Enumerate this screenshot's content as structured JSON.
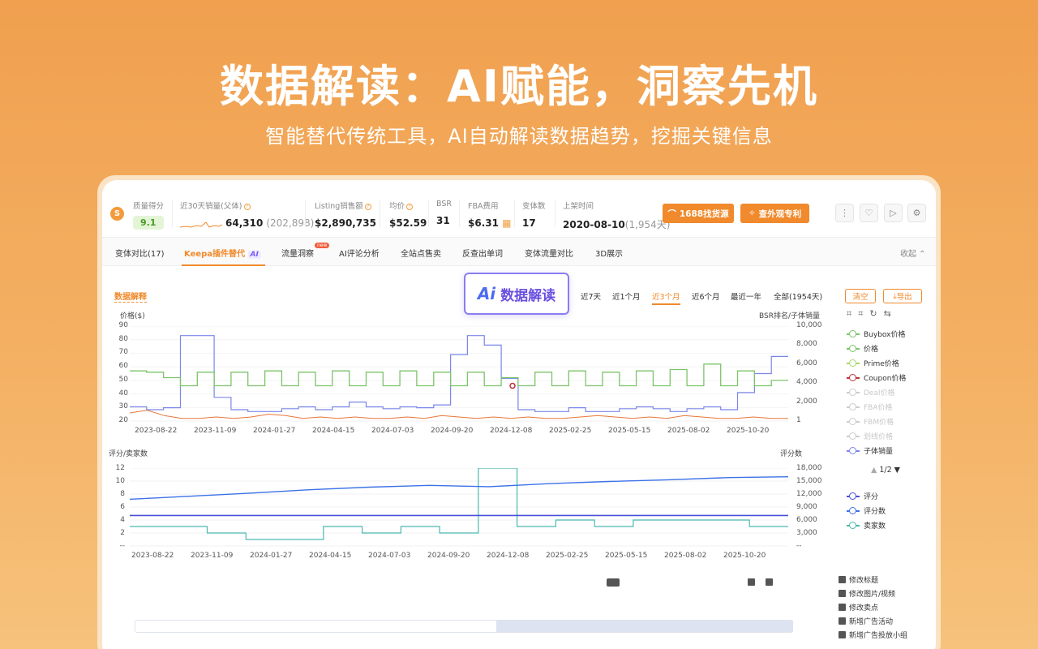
{
  "hero": {
    "title": "数据解读：AI赋能，洞察先机",
    "subtitle": "智能替代传统工具，AI自动解读数据趋势，挖掘关键信息"
  },
  "header": {
    "logo": "S",
    "metrics": [
      {
        "label": "质量得分",
        "value": "9.1"
      },
      {
        "label": "近30天销量(父体)",
        "value": "64,310",
        "value_muted": "(202,898)"
      },
      {
        "label": "Listing销售额",
        "value": "$2,890,735"
      },
      {
        "label": "均价",
        "value": "$52.59"
      },
      {
        "label": "BSR",
        "value": "31"
      },
      {
        "label": "FBA费用",
        "value": "$6.31"
      },
      {
        "label": "变体数",
        "value": "17"
      },
      {
        "label": "上架时间",
        "value": "2020-08-10",
        "value_muted": "(1,954天)"
      }
    ],
    "btn_1688": "1688找货源",
    "btn_patent": "查外观专利"
  },
  "tabs": [
    {
      "label": "变体对比(17)"
    },
    {
      "label": "Keepa插件替代"
    },
    {
      "label": "流量洞察"
    },
    {
      "label": "AI评论分析"
    },
    {
      "label": "全站点售卖"
    },
    {
      "label": "反查出单词"
    },
    {
      "label": "变体流量对比"
    },
    {
      "label": "3D展示"
    }
  ],
  "tab_ai_tag": "AI",
  "tab_new_tag": "new",
  "collapse_label": "收起",
  "toolbar": {
    "data_explain": "数据解释",
    "ai_mark": "Ai",
    "ai_label": "数据解读",
    "ranges": [
      "近7天",
      "近1个月",
      "近3个月",
      "近6个月",
      "最近一年",
      "全部(1954天)"
    ],
    "active_range": "近3个月",
    "clear": "清空",
    "export": "导出"
  },
  "chart_data": [
    {
      "type": "line",
      "ylabel": "价格($)",
      "y2label": "BSR排名/子体销量",
      "yticks": [
        "90",
        "80",
        "70",
        "60",
        "50",
        "40",
        "30",
        "20"
      ],
      "y2ticks": [
        "10,000",
        "8,000",
        "6,000",
        "4,000",
        "2,000",
        "1"
      ],
      "xticks": [
        "2023-08-22",
        "2023-11-09",
        "2024-01-27",
        "2024-04-15",
        "2024-07-03",
        "2024-09-20",
        "2024-12-08",
        "2025-02-25",
        "2025-05-15",
        "2025-08-02",
        "2025-10-20"
      ],
      "ylim": [
        20,
        90
      ],
      "y2lim": [
        1,
        10000
      ],
      "series": [
        {
          "name": "价格",
          "color": "#7cc46a",
          "values": [
            57,
            56,
            52,
            46,
            56,
            46,
            56,
            46,
            57,
            46,
            56,
            46,
            57,
            46,
            56,
            46,
            57,
            46,
            56,
            46,
            56,
            46,
            52,
            46,
            56,
            46,
            57,
            46,
            56,
            46,
            57,
            46,
            58,
            46,
            62,
            46,
            57,
            46,
            50
          ]
        },
        {
          "name": "子体销量",
          "color": "#7b86ea",
          "values": [
            1500,
            1200,
            1400,
            9000,
            9000,
            2500,
            1200,
            1000,
            1000,
            1300,
            1500,
            1200,
            1500,
            2000,
            1500,
            1300,
            1500,
            1400,
            1700,
            7000,
            9000,
            8000,
            4500,
            1200,
            1000,
            1000,
            1400,
            1000,
            1000,
            1300,
            1500,
            1300,
            1000,
            1300,
            1500,
            1200,
            3000,
            5000,
            6800
          ]
        },
        {
          "name": "Coupon价格",
          "color": "#e8763a",
          "values": [
            26,
            28,
            24,
            22,
            22,
            23,
            22,
            23,
            25,
            24,
            22,
            23,
            22,
            23,
            22,
            22,
            23,
            22,
            24,
            23,
            22,
            23,
            22,
            23,
            22,
            22,
            23,
            24,
            23,
            22,
            23,
            22,
            24,
            23,
            22,
            22,
            23,
            22,
            22
          ]
        }
      ]
    },
    {
      "type": "line",
      "ylabel": "评分/卖家数",
      "y2label": "评分数",
      "yticks": [
        "12",
        "10",
        "8",
        "6",
        "4",
        "2",
        "--"
      ],
      "y2ticks": [
        "18,000",
        "15,000",
        "12,000",
        "9,000",
        "6,000",
        "3,000",
        "--"
      ],
      "xticks": [
        "2023-08-22",
        "2023-11-09",
        "2024-01-27",
        "2024-04-15",
        "2024-07-03",
        "2024-09-20",
        "2024-12-08",
        "2025-02-25",
        "2025-05-15",
        "2025-08-02",
        "2025-10-20"
      ],
      "ylim": [
        0,
        12
      ],
      "y2lim": [
        0,
        18000
      ],
      "series": [
        {
          "name": "评分",
          "color": "#4a4fd8",
          "values": [
            4.7,
            4.7,
            4.7,
            4.7,
            4.7,
            4.7,
            4.7,
            4.7,
            4.7,
            4.7,
            4.7,
            4.7
          ]
        },
        {
          "name": "评分数",
          "color": "#3c72e8",
          "values": [
            10800,
            11500,
            12200,
            13000,
            13600,
            14000,
            13700,
            14400,
            14900,
            15300,
            15800,
            16000
          ]
        },
        {
          "name": "卖家数",
          "color": "#4ab8b0",
          "values": [
            3,
            3,
            2,
            1,
            1,
            3,
            2,
            3,
            2,
            12,
            3,
            4,
            3,
            4,
            4,
            4,
            3
          ]
        }
      ]
    }
  ],
  "legend": {
    "chart1": [
      {
        "name": "Buybox价格",
        "color": "#7cc46a",
        "on": true
      },
      {
        "name": "价格",
        "color": "#7cc46a",
        "on": true
      },
      {
        "name": "Prime价格",
        "color": "#a6d86a",
        "on": true
      },
      {
        "name": "Coupon价格",
        "color": "#c0303c",
        "on": true
      },
      {
        "name": "Deal价格",
        "color": "#cccccc",
        "on": false
      },
      {
        "name": "FBA价格",
        "color": "#cccccc",
        "on": false
      },
      {
        "name": "FBM价格",
        "color": "#cccccc",
        "on": false
      },
      {
        "name": "划线价格",
        "color": "#cccccc",
        "on": false
      },
      {
        "name": "子体销量",
        "color": "#7b86ea",
        "on": true
      }
    ],
    "pager": "1/2",
    "chart2": [
      {
        "name": "评分",
        "color": "#4a4fd8"
      },
      {
        "name": "评分数",
        "color": "#3c72e8"
      },
      {
        "name": "卖家数",
        "color": "#4ab8b0"
      }
    ]
  },
  "actions": [
    "修改标题",
    "修改图片/视频",
    "修改卖点",
    "新增广告活动",
    "新增广告投放小组"
  ]
}
